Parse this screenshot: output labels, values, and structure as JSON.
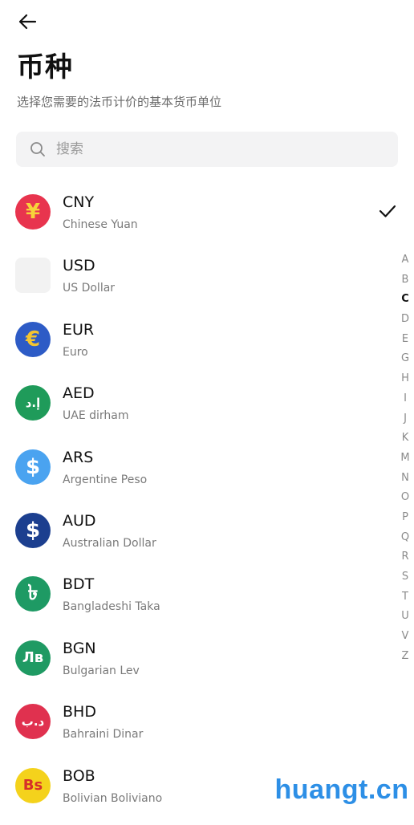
{
  "header": {
    "title": "币种",
    "subtitle": "选择您需要的法币计价的基本货币单位"
  },
  "search": {
    "placeholder": "搜索",
    "value": ""
  },
  "selected_currency": "CNY",
  "currencies": [
    {
      "code": "CNY",
      "name": "Chinese Yuan",
      "symbol": "¥",
      "bg": "#e8344e",
      "fg": "#f7d23a",
      "selected": true
    },
    {
      "code": "USD",
      "name": "US Dollar",
      "symbol": "",
      "bg": "#f2f2f2",
      "fg": "#f2f2f2",
      "selected": false
    },
    {
      "code": "EUR",
      "name": "Euro",
      "symbol": "€",
      "bg": "#2d5bc6",
      "fg": "#f4c430",
      "selected": false
    },
    {
      "code": "AED",
      "name": "UAE dirham",
      "symbol": "إ.د",
      "bg": "#1f9b5a",
      "fg": "#ffffff",
      "selected": false
    },
    {
      "code": "ARS",
      "name": "Argentine Peso",
      "symbol": "$",
      "bg": "#4aa3f0",
      "fg": "#ffffff",
      "selected": false
    },
    {
      "code": "AUD",
      "name": "Australian Dollar",
      "symbol": "$",
      "bg": "#1c3f8f",
      "fg": "#ffffff",
      "selected": false
    },
    {
      "code": "BDT",
      "name": "Bangladeshi Taka",
      "symbol": "৳",
      "bg": "#1e9a64",
      "fg": "#ffffff",
      "selected": false
    },
    {
      "code": "BGN",
      "name": "Bulgarian Lev",
      "symbol": "Лв",
      "bg": "#1f9a63",
      "fg": "#ffffff",
      "selected": false
    },
    {
      "code": "BHD",
      "name": "Bahraini Dinar",
      "symbol": "د.ب",
      "bg": "#e0314f",
      "fg": "#ffffff",
      "selected": false
    },
    {
      "code": "BOB",
      "name": "Bolivian Boliviano",
      "symbol": "Bs",
      "bg": "#f4d21c",
      "fg": "#d6302a",
      "selected": false
    }
  ],
  "alphabet_index": {
    "letters": [
      "A",
      "B",
      "C",
      "D",
      "E",
      "G",
      "H",
      "I",
      "J",
      "K",
      "M",
      "N",
      "O",
      "P",
      "Q",
      "R",
      "S",
      "T",
      "U",
      "V",
      "Z"
    ],
    "active": "C"
  },
  "watermark": "huangt.cn",
  "icons": {
    "back": "arrow-left-icon",
    "search": "search-icon",
    "selected": "checkmark-icon"
  }
}
